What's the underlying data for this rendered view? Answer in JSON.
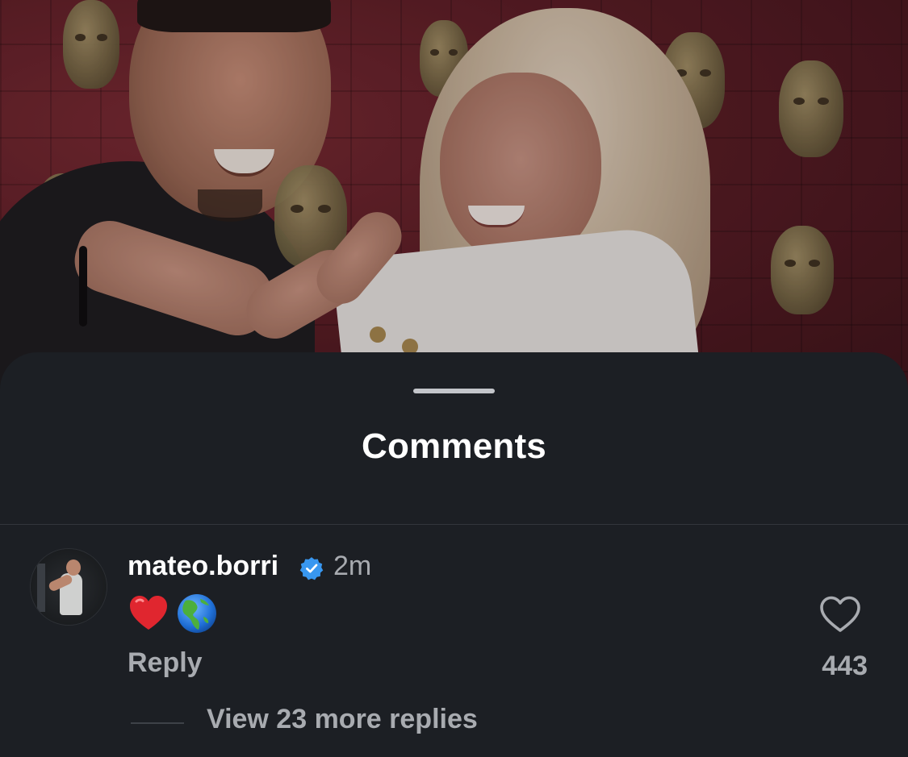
{
  "sheet": {
    "title": "Comments"
  },
  "comment": {
    "username": "mateo.borri",
    "verified": true,
    "timestamp": "2m",
    "emojis": [
      "red-heart-emoji",
      "globe-americas-emoji"
    ],
    "reply_label": "Reply",
    "like_count": "443",
    "view_replies_label": "View 23 more replies"
  },
  "colors": {
    "sheet_background": "#1c1f24",
    "primary_text": "#ffffff",
    "secondary_text": "#a8abb0",
    "verified_badge": "#3897f0",
    "heart_emoji": "#e0262f"
  },
  "icons": {
    "verified": "verified-badge-icon",
    "like": "heart-outline-icon",
    "grabber": "drag-handle"
  }
}
